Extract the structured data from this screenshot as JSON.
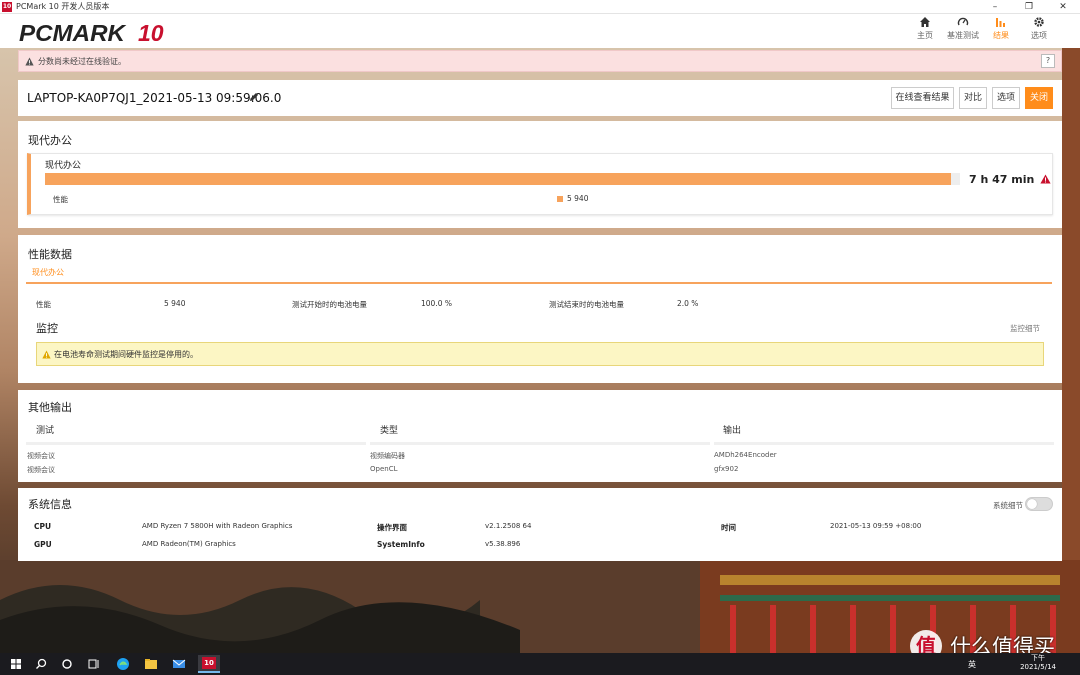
{
  "window": {
    "title": "PCMark 10 开发人员版本",
    "app_icon": "10"
  },
  "header": {
    "logo_text": "PCMARK",
    "logo_num": "10",
    "nav": [
      {
        "label": "主页",
        "icon": "home-icon"
      },
      {
        "label": "基准测试",
        "icon": "gauge-icon"
      },
      {
        "label": "结果",
        "icon": "bar-chart-icon",
        "active": true
      },
      {
        "label": "选项",
        "icon": "gear-icon"
      }
    ]
  },
  "warning": {
    "text": "分数尚未经过在线验证。",
    "help": "?"
  },
  "result": {
    "name": "LAPTOP-KA0P7QJ1_2021-05-13 09:59:06.0",
    "buttons": {
      "online": "在线查看结果",
      "compare": "对比",
      "options": "选项",
      "close": "关闭"
    }
  },
  "office": {
    "section_title": "现代办公",
    "card_title": "现代办公",
    "score": "7 h 47 min",
    "score_fraction": 0.99,
    "perf_label": "性能",
    "perf_value": "5 940"
  },
  "perf_data": {
    "title": "性能数据",
    "tab": "现代办公",
    "row": {
      "k1": "性能",
      "v1": "5 940",
      "k2": "测试开始时的电池电量",
      "v2": "100.0 %",
      "k3": "测试结束时的电池电量",
      "v3": "2.0 %"
    },
    "monitor_title": "监控",
    "monitor_link": "监控细节",
    "monitor_warning": "在电池寿命测试期间硬件监控是停用的。"
  },
  "other": {
    "title": "其他输出",
    "headers": [
      "测试",
      "类型",
      "输出"
    ],
    "rows": [
      [
        "视频会议",
        "视频编码器",
        "AMDh264Encoder"
      ],
      [
        "视频会议",
        "OpenCL",
        "gfx902"
      ]
    ]
  },
  "sysinfo": {
    "title": "系统信息",
    "toggle_label": "系统细节",
    "cpu_k": "CPU",
    "cpu_v": "AMD Ryzen 7 5800H with Radeon Graphics",
    "gpu_k": "GPU",
    "gpu_v": "AMD Radeon(TM) Graphics",
    "os_k": "操作界面",
    "os_v": "v2.1.2508 64",
    "si_k": "SystemInfo",
    "si_v": "v5.38.896",
    "time_k": "时间",
    "time_v": "2021-05-13 09:59 +08:00"
  },
  "taskbar": {
    "lang": "英",
    "time": "下午",
    "date": "2021/5/14"
  },
  "watermark": {
    "logo": "值",
    "text": "什么值得买"
  },
  "colors": {
    "accent": "#ff8c1a",
    "bar": "#f7a35c",
    "brand_red": "#c8102e"
  }
}
